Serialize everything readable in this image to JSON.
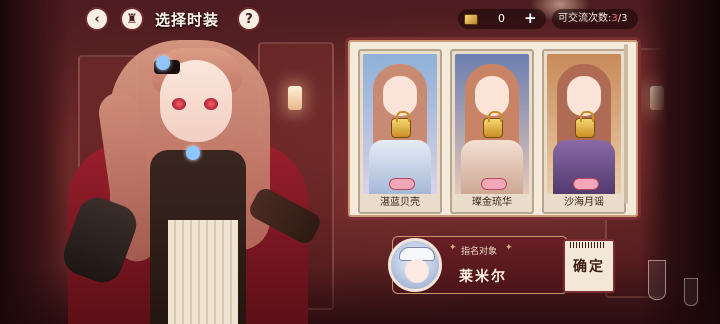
{
  "header": {
    "title": "选择时装",
    "back_icon": "back-arrow-icon",
    "home_icon": "castle-home-icon",
    "help_label": "?"
  },
  "currency": {
    "icon": "ticket-icon",
    "value": "0",
    "add_label": "+"
  },
  "exchange": {
    "label": "可交流次数:",
    "current": "3",
    "total": "/3"
  },
  "outfits": [
    {
      "name": "湛蓝贝壳",
      "locked": true,
      "hair": "#c98a74",
      "dress": "#cfd8ea"
    },
    {
      "name": "璨金琉华",
      "locked": true,
      "hair": "#c98365",
      "dress": "#e9cfc0"
    },
    {
      "name": "沙海月谣",
      "locked": true,
      "hair": "#b06b55",
      "dress": "#6b4a8a"
    }
  ],
  "target": {
    "label": "指名对象",
    "name": "莱米尔"
  },
  "confirm": {
    "label": "确定"
  },
  "colors": {
    "accent": "#7a2d32",
    "highlight": "#ff6a6a",
    "panel": "#f4ebdd"
  }
}
